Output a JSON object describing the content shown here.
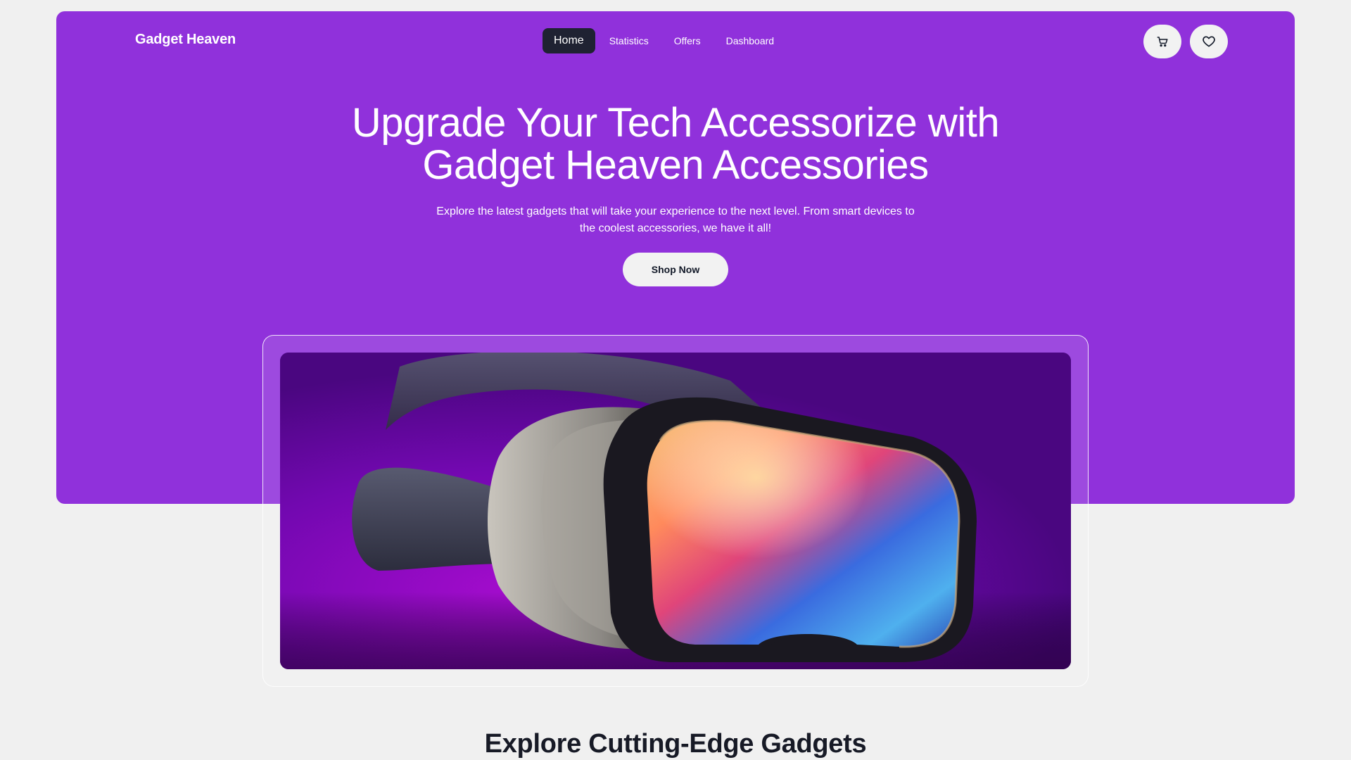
{
  "brand": "Gadget Heaven",
  "nav": {
    "links": [
      "Home",
      "Statistics",
      "Offers",
      "Dashboard"
    ],
    "active_index": 0
  },
  "actions": {
    "cart_icon": "cart-icon",
    "wishlist_icon": "heart-icon"
  },
  "hero": {
    "title_line1": "Upgrade Your Tech Accessorize with",
    "title_line2": "Gadget Heaven Accessories",
    "subtitle_line1": "Explore the latest gadgets that will take your experience to the next level. From smart devices to",
    "subtitle_line2": "the coolest accessories, we have it all!",
    "cta": "Shop Now",
    "banner_image": "vr-headset-image"
  },
  "section": {
    "title": "Explore Cutting-Edge Gadgets"
  },
  "colors": {
    "primary": "#9031db",
    "dark": "#1f2232",
    "light": "#f2f2f2",
    "page_bg": "#f0f0f0"
  }
}
